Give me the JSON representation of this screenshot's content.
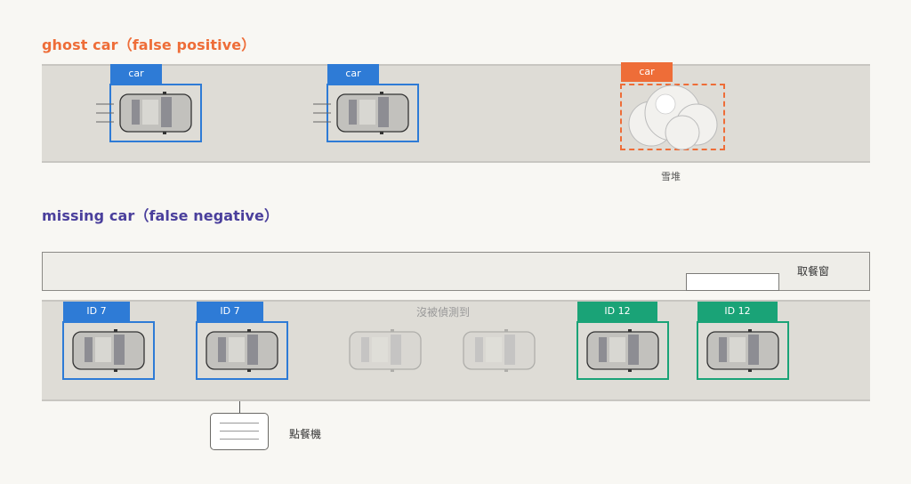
{
  "section_ghost": {
    "title": "ghost car（false positive）",
    "color": "#ee6d38"
  },
  "section_missing": {
    "title": "missing car（false negative）",
    "color": "#4a3f9c"
  },
  "colors": {
    "road": "#dedcd6",
    "box_blue": "#2e7bd6",
    "box_green": "#1aa377",
    "box_orange": "#ee6d38"
  },
  "ghost_row": {
    "tags": [
      "car",
      "car",
      "car"
    ],
    "snow_label": "雪堆"
  },
  "missing_row": {
    "counter_label": "取餐窗",
    "tags": [
      "ID 7",
      "ID 7",
      "ID 12",
      "ID 12"
    ],
    "undetected_label": "沒被偵測到",
    "kiosk_label": "點餐機"
  }
}
